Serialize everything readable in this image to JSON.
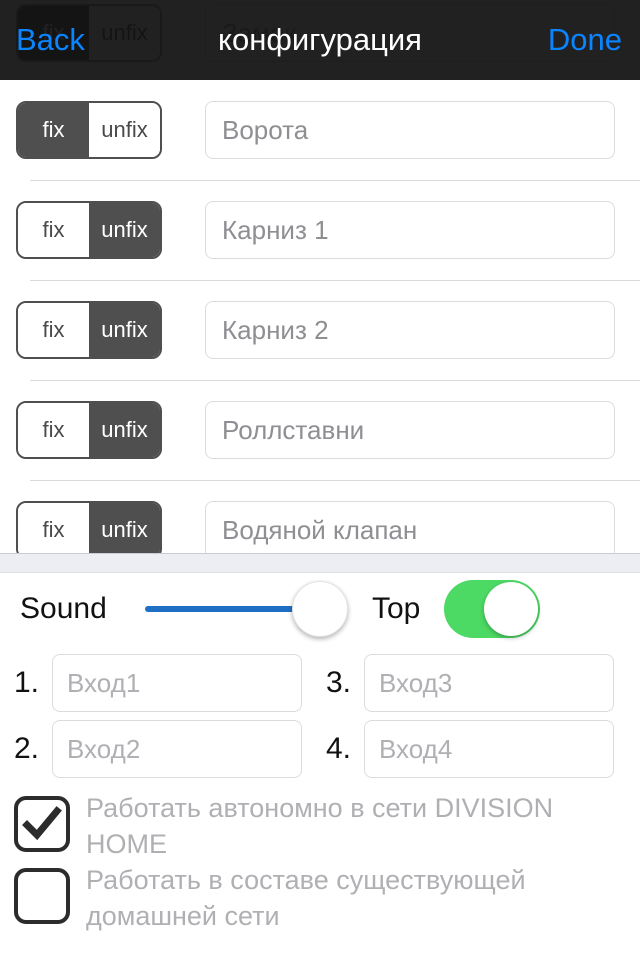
{
  "navbar": {
    "back_label": "Back",
    "title": "конфигурация",
    "done_label": "Done",
    "accent_color": "#0a84ff",
    "background_color": "#101010"
  },
  "peek_row": {
    "segment_fix": "fix",
    "segment_unfix": "unfix",
    "field_text": "Замок"
  },
  "device_rows": [
    {
      "fix_label": "fix",
      "unfix_label": "unfix",
      "selected": "fix",
      "name": "Ворота"
    },
    {
      "fix_label": "fix",
      "unfix_label": "unfix",
      "selected": "unfix",
      "name": "Карниз 1"
    },
    {
      "fix_label": "fix",
      "unfix_label": "unfix",
      "selected": "unfix",
      "name": "Карниз 2"
    },
    {
      "fix_label": "fix",
      "unfix_label": "unfix",
      "selected": "unfix",
      "name": "Роллставни"
    },
    {
      "fix_label": "fix",
      "unfix_label": "unfix",
      "selected": "unfix",
      "name": "Водяной клапан"
    }
  ],
  "controls": {
    "sound_label": "Sound",
    "sound_value_percent": 100,
    "slider_track_color": "#1f6fc4",
    "top_label": "Top",
    "top_enabled": true,
    "toggle_on_color": "#4cd964"
  },
  "numbered_inputs": [
    {
      "number": "1.",
      "placeholder": "Вход1",
      "value": ""
    },
    {
      "number": "2.",
      "placeholder": "Вход2",
      "value": ""
    },
    {
      "number": "3.",
      "placeholder": "Вход3",
      "value": ""
    },
    {
      "number": "4.",
      "placeholder": "Вход4",
      "value": ""
    }
  ],
  "checkboxes": [
    {
      "checked": true,
      "label": "Работать автономно в сети DIVISION HOME"
    },
    {
      "checked": false,
      "label": "Работать в составе существующей домашней сети"
    }
  ]
}
